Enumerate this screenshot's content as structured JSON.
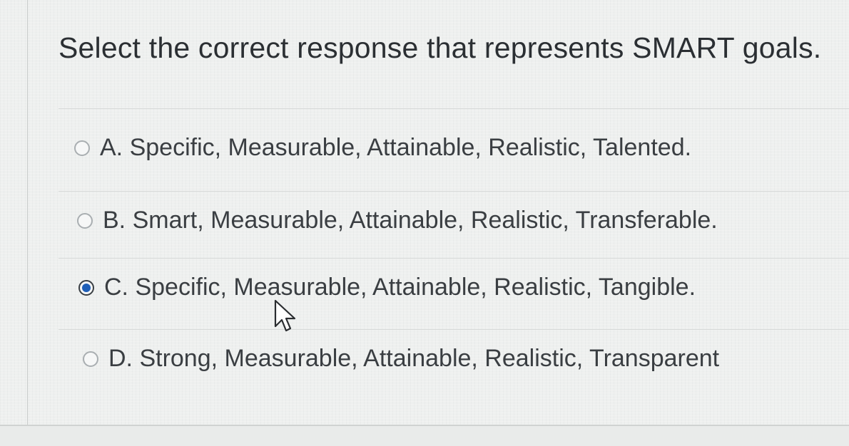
{
  "question": {
    "text": "Select the correct response that represents SMART goals."
  },
  "options": [
    {
      "label": "A. Specific, Measurable, Attainable, Realistic, Talented.",
      "selected": false
    },
    {
      "label": "B. Smart, Measurable, Attainable, Realistic, Transferable.",
      "selected": false
    },
    {
      "label": "C. Specific, Measurable, Attainable, Realistic, Tangible.",
      "selected": true
    },
    {
      "label": "D. Strong, Measurable, Attainable, Realistic, Transparent",
      "selected": false
    }
  ],
  "colors": {
    "accent": "#1f5fb8",
    "background": "#eef0ef",
    "text": "#2f3336"
  }
}
